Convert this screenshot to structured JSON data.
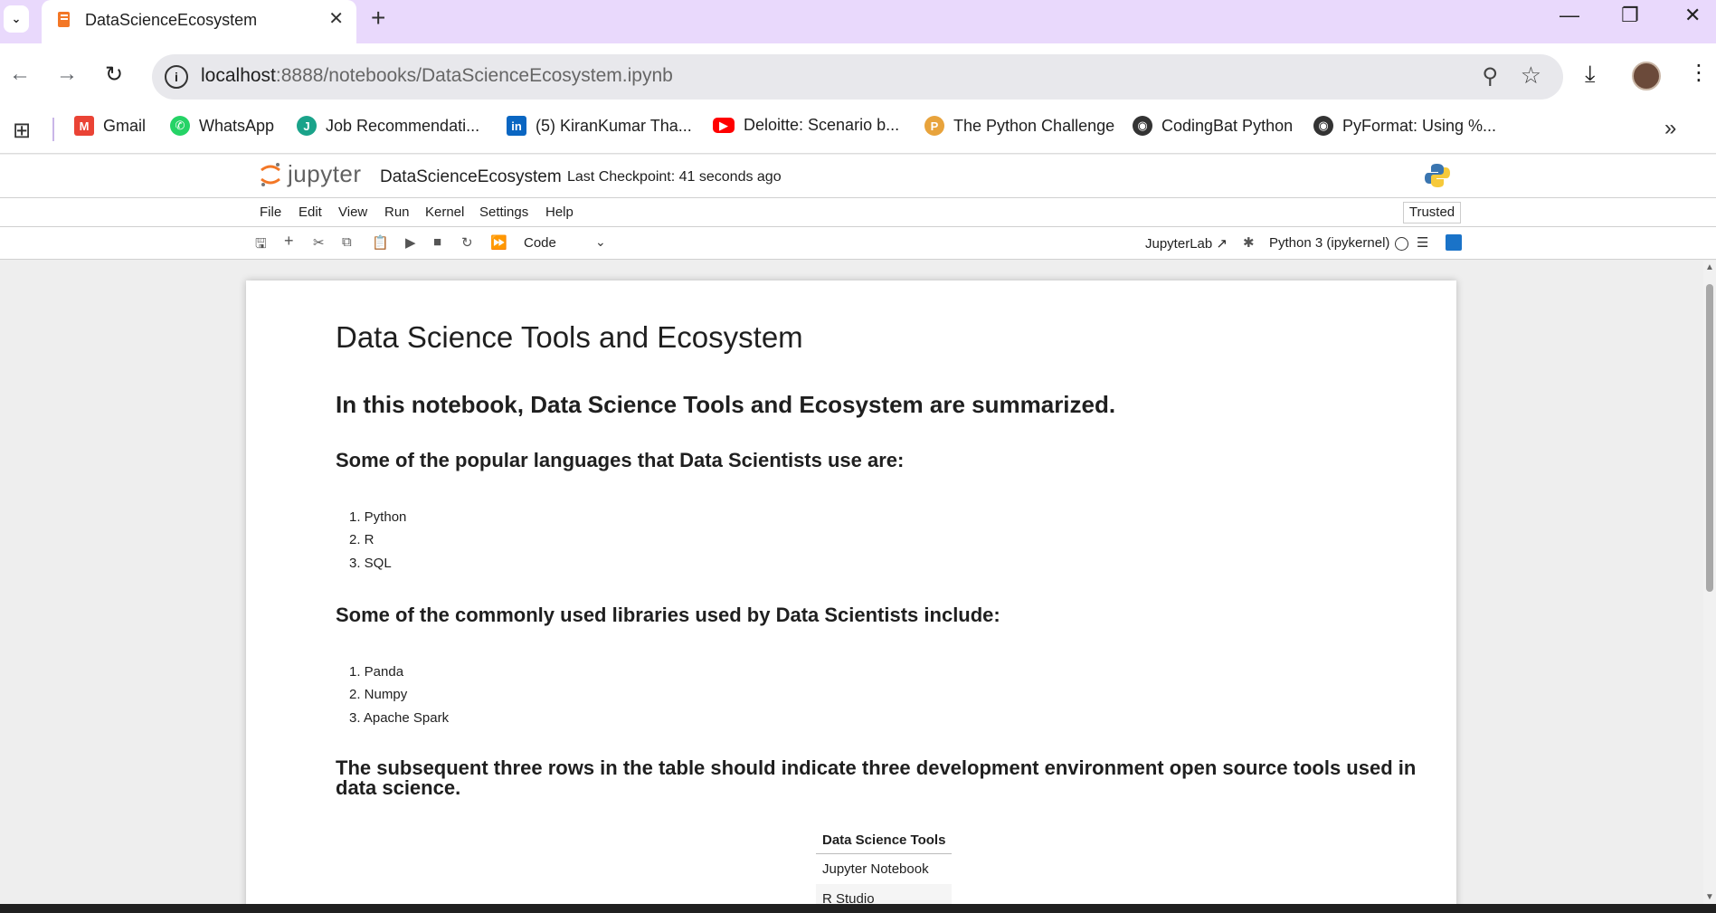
{
  "browser": {
    "tab_title": "DataScienceEcosystem",
    "url_host": "localhost",
    "url_rest": ":8888/notebooks/DataScienceEcosystem.ipynb",
    "bookmarks": [
      {
        "label": "Gmail",
        "icon": "gmail-icon",
        "color": "#ea4335"
      },
      {
        "label": "WhatsApp",
        "icon": "whatsapp-icon",
        "color": "#25d366"
      },
      {
        "label": "Job Recommendati...",
        "icon": "job-icon",
        "color": "#1aa38a"
      },
      {
        "label": "(5) KiranKumar Tha...",
        "icon": "linkedin-icon",
        "color": "#0a66c2"
      },
      {
        "label": "Deloitte: Scenario b...",
        "icon": "youtube-icon",
        "color": "#ff0000"
      },
      {
        "label": "The Python Challenge",
        "icon": "python-challenge-icon",
        "color": "#e8a33c"
      },
      {
        "label": "CodingBat Python",
        "icon": "globe-icon",
        "color": "#333333"
      },
      {
        "label": "PyFormat: Using %...",
        "icon": "globe-icon",
        "color": "#333333"
      }
    ]
  },
  "jupyter": {
    "logo_text": "jupyter",
    "notebook_title": "DataScienceEcosystem",
    "checkpoint": "Last Checkpoint: 41 seconds ago",
    "menu": [
      "File",
      "Edit",
      "View",
      "Run",
      "Kernel",
      "Settings",
      "Help"
    ],
    "trusted": "Trusted",
    "cell_type": "Code",
    "jupyterlab_link": "JupyterLab",
    "kernel": "Python 3 (ipykernel)"
  },
  "notebook": {
    "title": "Data Science Tools and Ecosystem",
    "intro": "In this notebook, Data Science Tools and Ecosystem are summarized.",
    "languages_heading": "Some of the popular languages that Data Scientists use are:",
    "languages": [
      "1. Python",
      "2. R",
      "3. SQL"
    ],
    "libraries_heading": "Some of the commonly used libraries used by Data Scientists include:",
    "libraries": [
      "1. Panda",
      "2. Numpy",
      "3. Apache Spark"
    ],
    "table_heading_line1": "The subsequent three rows in the table should indicate three development environment open source tools used in",
    "table_heading_line2": "data science.",
    "table_header": "Data Science Tools",
    "table_rows": [
      "Jupyter Notebook",
      "R Studio"
    ]
  }
}
